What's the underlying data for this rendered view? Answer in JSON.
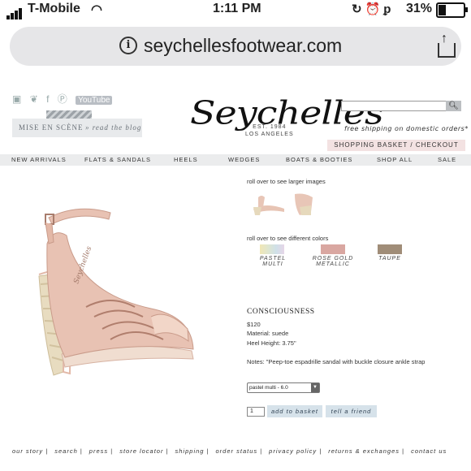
{
  "status": {
    "carrier": "T-Mobile",
    "time": "1:11 PM",
    "battery": "31%"
  },
  "browser": {
    "url": "seychellesfootwear.com"
  },
  "site": {
    "social": [
      "instagram-icon",
      "twitter-icon",
      "facebook-icon",
      "pinterest-icon",
      "YouTube"
    ],
    "blog": {
      "title": "MISE EN SCÈNE",
      "link": "» read the blog"
    },
    "logo": "Seychelles",
    "logo_sub": [
      "EST. 1984",
      "LOS ANGELES"
    ],
    "free_shipping": "free shipping on domestic orders*",
    "basket": "SHOPPING BASKET  /  CHECKOUT",
    "nav": [
      "NEW ARRIVALS",
      "FLATS & SANDALS",
      "HEELS",
      "WEDGES",
      "BOATS & BOOTIES",
      "SHOP ALL",
      "SALE"
    ]
  },
  "product": {
    "roll_images": "roll over to see larger images",
    "roll_colors": "roll over to see different colors",
    "colors": [
      {
        "label": "PASTEL MULTI",
        "color": "#dfe6cf"
      },
      {
        "label": "ROSE GOLD METALLIC",
        "color": "#d9a7a1"
      },
      {
        "label": "TAUPE",
        "color": "#a08d78"
      }
    ],
    "name": "CONSCIOUSNESS",
    "price": "$120",
    "material": "Material: suede",
    "heel": "Heel Height: 3.75\"",
    "notes": "Notes: \"Peep-toe espadrille sandal with buckle closure ankle strap",
    "size_select": "pastel multi - 6.0",
    "qty": "1",
    "add_to_basket": "add to basket",
    "tell_friend": "tell a friend"
  },
  "footer": [
    "our story",
    "search",
    "press",
    "store locator",
    "shipping",
    "order status",
    "privacy policy",
    "returns & exchanges",
    "contact us"
  ]
}
